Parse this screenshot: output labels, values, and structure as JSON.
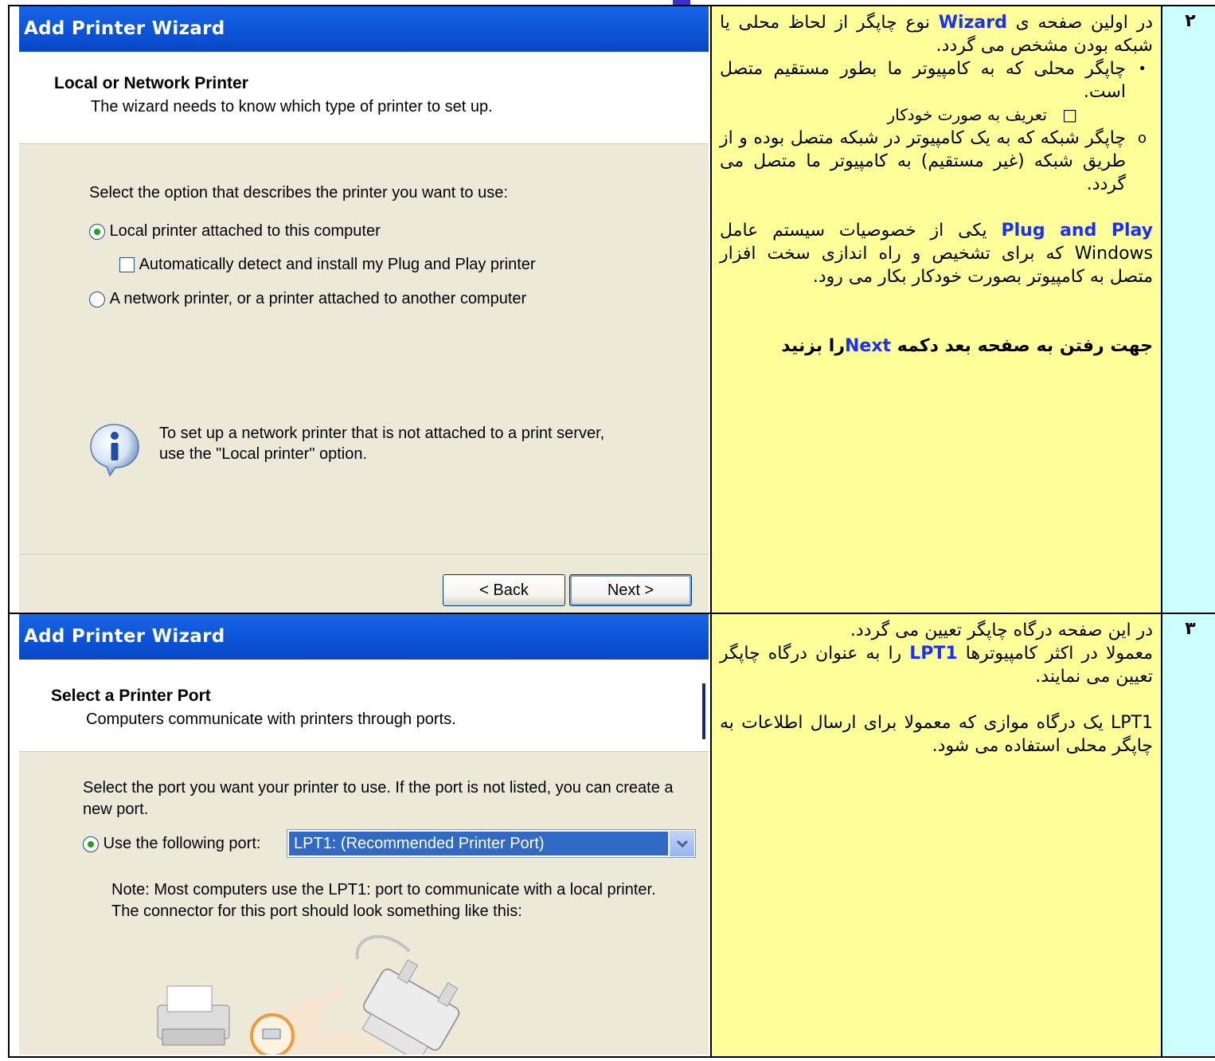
{
  "rows": [
    {
      "number": "۲",
      "wizard": {
        "title": "Add Printer Wizard",
        "header_title": "Local or Network Printer",
        "header_subtitle": "The wizard needs to know which type of printer to set up.",
        "prompt": "Select the option that describes the printer you want to use:",
        "option_local": "Local printer attached to this computer",
        "option_autodetect": "Automatically detect and install my Plug and Play printer",
        "option_network": "A network printer, or a printer attached to another computer",
        "info_text_line1": "To set up a network printer that is not attached to a print server,",
        "info_text_line2": "use the \"Local printer\" option.",
        "back_label": "< Back",
        "next_label": "Next >"
      },
      "text": {
        "p1_a": "در اولین صفحه ی ",
        "p1_hl": "Wizard",
        "p1_b": " نوع چاپگر از لحاظ محلی یا شبکه بودن مشخص می گردد.",
        "bullet1": "چاپگر محلی که به کامپیوتر ما بطور مستقیم متصل است.",
        "bullet1_marker": "•",
        "sub1": "تعریف به صورت خودکار",
        "sub1_marker": "□",
        "bullet2": "چاپگر شبکه که به یک کامپیوتر در شبکه متصل بوده و از طریق شبکه (غیر مستقیم) به کامپیوتر ما متصل می گردد.",
        "bullet2_marker": "o",
        "p2_hl": "Plug and Play",
        "p2_b": " یکی از خصوصیات سیستم عامل Windows که برای تشخیص و راه اندازی سخت افزار متصل به کامپیوتر بصورت خودکار بکار می رود.",
        "p3_a": "جهت رفتن به صفحه بعد دکمه  ",
        "p3_hl": "Next",
        "p3_b": "را بزنید"
      }
    },
    {
      "number": "۳",
      "wizard": {
        "title": "Add Printer Wizard",
        "header_title": "Select a Printer Port",
        "header_subtitle": "Computers communicate with printers through ports.",
        "prompt_line1": "Select the port you want your printer to use.  If the port is not listed, you can create a",
        "prompt_line2": "new port.",
        "use_port_label": "Use the following port:",
        "port_value": "LPT1: (Recommended Printer Port)",
        "note_line1": "Note: Most computers use the LPT1: port to communicate with a local printer.",
        "note_line2": "The connector for this port should look something like this:"
      },
      "text": {
        "p1": "در این صفحه درگاه چاپگر تعیین می گردد.",
        "p2_a": " معمولا در اکثر کامپیوترها ",
        "p2_hl": "LPT1",
        "p2_b": "  را به عنوان درگاه چاپگر تعیین می نمایند.",
        "p3": "LPT1 یک درگاه موازی که معمولا برای ارسال اطلاعات به چاپگر محلی استفاده می شود."
      }
    }
  ],
  "colors": {
    "text_cell": "#ffff99",
    "number_cell": "#ccffff",
    "highlight": "#1a2fff",
    "title_bar": "#0b53d6",
    "dialog_body": "#ece9d8"
  }
}
